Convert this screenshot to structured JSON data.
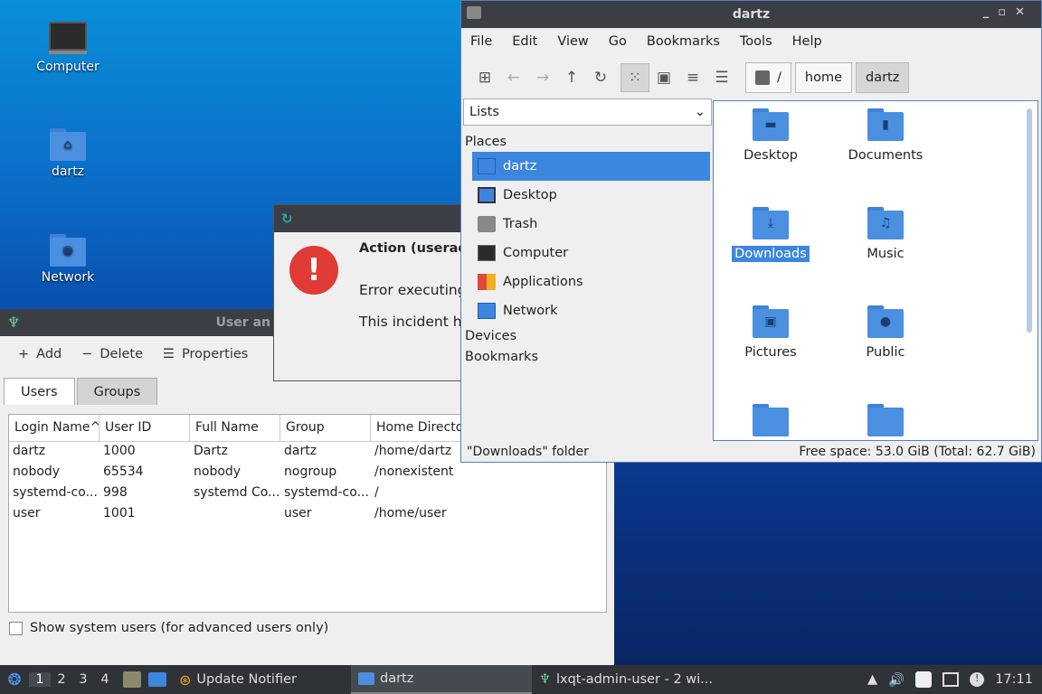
{
  "desktop": {
    "icons": [
      {
        "label": "Computer",
        "icon": "computer-icon"
      },
      {
        "label": "dartz",
        "icon": "home-folder-icon"
      },
      {
        "label": "Network",
        "icon": "network-folder-icon"
      }
    ]
  },
  "user_window": {
    "title": "User an",
    "toolbar": {
      "add": "Add",
      "delete": "Delete",
      "properties": "Properties"
    },
    "tabs": [
      "Users",
      "Groups"
    ],
    "columns": [
      "Login Name",
      "User ID",
      "Full Name",
      "Group",
      "Home Directo"
    ],
    "rows": [
      [
        "dartz",
        "1000",
        "Dartz",
        "dartz",
        "/home/dartz"
      ],
      [
        "nobody",
        "65534",
        "nobody",
        "nogroup",
        "/nonexistent"
      ],
      [
        "systemd-co...",
        "998",
        "systemd Co...",
        "systemd-co...",
        "/"
      ],
      [
        "user",
        "1001",
        "",
        "user",
        "/home/user"
      ]
    ],
    "show_system_users": "Show system users (for advanced users only)"
  },
  "dialog": {
    "title_text": "Action (useradd",
    "line1": "Error executing",
    "line2": "This incident h"
  },
  "file_manager": {
    "title": "dartz",
    "menu": [
      "File",
      "Edit",
      "View",
      "Go",
      "Bookmarks",
      "Tools",
      "Help"
    ],
    "breadcrumbs": [
      "/",
      "home",
      "dartz"
    ],
    "side_select": "Lists",
    "places_header": "Places",
    "places": [
      {
        "label": "dartz",
        "icon": "home-icon",
        "selected": true
      },
      {
        "label": "Desktop",
        "icon": "desktop-icon"
      },
      {
        "label": "Trash",
        "icon": "trash-icon"
      },
      {
        "label": "Computer",
        "icon": "computer-icon"
      },
      {
        "label": "Applications",
        "icon": "applications-icon"
      },
      {
        "label": "Network",
        "icon": "network-icon"
      }
    ],
    "devices_header": "Devices",
    "bookmarks_header": "Bookmarks",
    "files": [
      {
        "label": "Desktop",
        "glyph": "▬"
      },
      {
        "label": "Documents",
        "glyph": "▮"
      },
      {
        "label": "Downloads",
        "glyph": "⤓",
        "selected": true
      },
      {
        "label": "Music",
        "glyph": "♫"
      },
      {
        "label": "Pictures",
        "glyph": "▣"
      },
      {
        "label": "Public",
        "glyph": "●"
      },
      {
        "label": "",
        "glyph": ""
      },
      {
        "label": "",
        "glyph": ""
      }
    ],
    "status_left": "\"Downloads\" folder",
    "status_right": "Free space: 53.0 GiB (Total: 62.7 GiB)"
  },
  "taskbar": {
    "workspaces": [
      "1",
      "2",
      "3",
      "4"
    ],
    "tasks": [
      {
        "label": "Update Notifier"
      },
      {
        "label": "dartz"
      },
      {
        "label": "lxqt-admin-user - 2 wi..."
      }
    ],
    "clock": "17:11"
  },
  "colors": {
    "accent": "#3d86e0",
    "titlebar": "#3b3f45",
    "error": "#e03b35"
  }
}
